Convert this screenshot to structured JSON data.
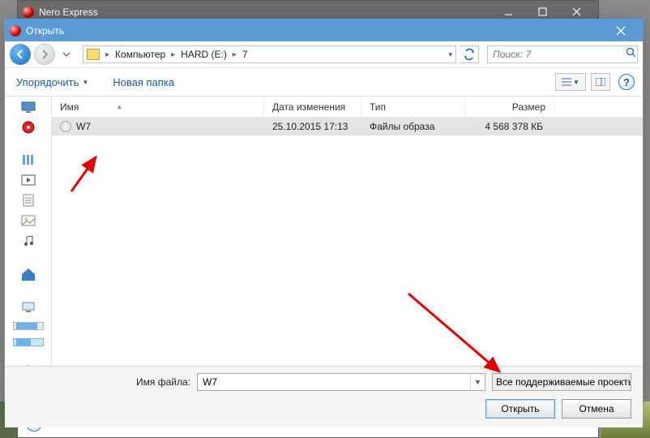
{
  "parent": {
    "title": "Nero Express"
  },
  "dialog": {
    "title": "Открыть",
    "breadcrumb": {
      "root": "Компьютер",
      "drive": "HARD (E:)",
      "folder": "7"
    },
    "search_placeholder": "Поиск: 7",
    "toolbar": {
      "organize": "Упорядочить",
      "newfolder": "Новая папка"
    },
    "columns": {
      "name": "Имя",
      "date": "Дата изменения",
      "type": "Тип",
      "size": "Размер"
    },
    "files": [
      {
        "name": "W7",
        "date": "25.10.2015 17:13",
        "type": "Файлы образа",
        "size": "4 568 378 КБ"
      }
    ],
    "footer": {
      "filename_label": "Имя файла:",
      "filename_value": "W7",
      "filter": "Все поддерживаемые проекты",
      "open": "Открыть",
      "cancel": "Отмена"
    }
  }
}
